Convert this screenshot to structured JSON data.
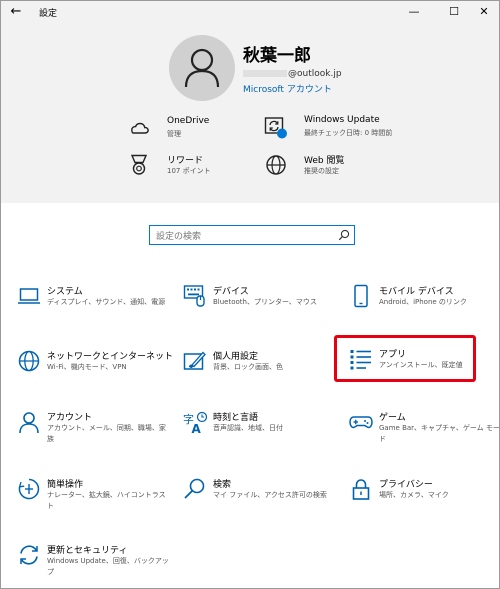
{
  "window": {
    "title": "設定",
    "back_icon": "back-arrow-icon",
    "minimize_glyph": "—",
    "maximize_glyph": "☐",
    "close_glyph": "✕"
  },
  "account": {
    "name": "秋葉一郎",
    "email_suffix": "@outlook.jp",
    "link_label": "Microsoft アカウント"
  },
  "quick_links": [
    {
      "icon": "onedrive-cloud-icon",
      "title": "OneDrive",
      "subtitle": "管理"
    },
    {
      "icon": "windows-update-icon",
      "title": "Windows Update",
      "subtitle": "最終チェック日時: 0 時間前"
    },
    {
      "icon": "rewards-medal-icon",
      "title": "リワード",
      "subtitle": "107 ポイント"
    },
    {
      "icon": "web-globe-icon",
      "title": "Web 閲覧",
      "subtitle": "推奨の設定"
    }
  ],
  "search": {
    "placeholder": "設定の検索"
  },
  "categories": [
    {
      "icon": "laptop-icon",
      "title": "システム",
      "subtitle": "ディスプレイ、サウンド、通知、電源"
    },
    {
      "icon": "keyboard-icon",
      "title": "デバイス",
      "subtitle": "Bluetooth、プリンター、マウス"
    },
    {
      "icon": "phone-icon",
      "title": "モバイル デバイス",
      "subtitle": "Android、iPhone のリンク"
    },
    {
      "icon": "globe-icon",
      "title": "ネットワークとインターネット",
      "subtitle": "Wi-Fi、機内モード、VPN"
    },
    {
      "icon": "personalization-icon",
      "title": "個人用設定",
      "subtitle": "背景、ロック画面、色"
    },
    {
      "icon": "apps-list-icon",
      "title": "アプリ",
      "subtitle": "アンインストール、既定値"
    },
    {
      "icon": "person-icon",
      "title": "アカウント",
      "subtitle": "アカウント、メール、同期、職場、家族"
    },
    {
      "icon": "time-language-icon",
      "title": "時刻と言語",
      "subtitle": "音声認識、地域、日付"
    },
    {
      "icon": "gamepad-icon",
      "title": "ゲーム",
      "subtitle": "Game Bar、キャプチャ、ゲーム モード"
    },
    {
      "icon": "ease-of-access-icon",
      "title": "簡単操作",
      "subtitle": "ナレーター、拡大鏡、ハイコントラスト"
    },
    {
      "icon": "search-magnifier-icon",
      "title": "検索",
      "subtitle": "マイ ファイル、アクセス許可の検索"
    },
    {
      "icon": "lock-icon",
      "title": "プライバシー",
      "subtitle": "場所、カメラ、マイク"
    },
    {
      "icon": "update-security-icon",
      "title": "更新とセキュリティ",
      "subtitle": "Windows Update、回復、バックアップ"
    }
  ],
  "colors": {
    "accent": "#0078d7",
    "header_bg": "#f2f2f2",
    "highlight": "#e60012"
  }
}
